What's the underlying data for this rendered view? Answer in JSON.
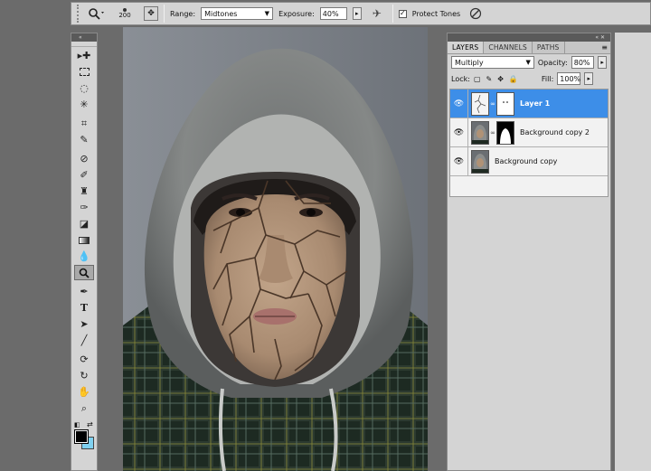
{
  "options_bar": {
    "tool_icon": "dodge-tool-icon",
    "brush_size": "200",
    "range_label": "Range:",
    "range_value": "Midtones",
    "exposure_label": "Exposure:",
    "exposure_value": "40%",
    "protect_tones_label": "Protect Tones",
    "protect_tones_checked": true
  },
  "toolbox": {
    "tools": [
      "move",
      "marquee",
      "lasso",
      "magic-wand",
      "crop",
      "eyedropper",
      "healing",
      "brush",
      "clone-stamp",
      "history-brush",
      "eraser",
      "gradient",
      "blur",
      "dodge",
      "pen",
      "type",
      "path-select",
      "line",
      "3d-rotate",
      "3d-orbit",
      "hand",
      "zoom"
    ],
    "active_tool": "dodge",
    "foreground_color": "#000000",
    "background_color": "#7fd1f0"
  },
  "layers_panel": {
    "tabs": [
      "LAYERS",
      "CHANNELS",
      "PATHS"
    ],
    "active_tab": "LAYERS",
    "blend_mode": "Multiply",
    "opacity_label": "Opacity:",
    "opacity_value": "80%",
    "lock_label": "Lock:",
    "fill_label": "Fill:",
    "fill_value": "100%",
    "layers": [
      {
        "name": "Layer 1",
        "selected": true,
        "has_mask": true
      },
      {
        "name": "Background copy 2",
        "selected": false,
        "has_mask": true
      },
      {
        "name": "Background copy",
        "selected": false,
        "has_mask": false
      }
    ]
  },
  "colors": {
    "selection_blue": "#3d8ee8",
    "panel_gray": "#d4d4d4",
    "workspace_gray": "#6b6b6b"
  }
}
